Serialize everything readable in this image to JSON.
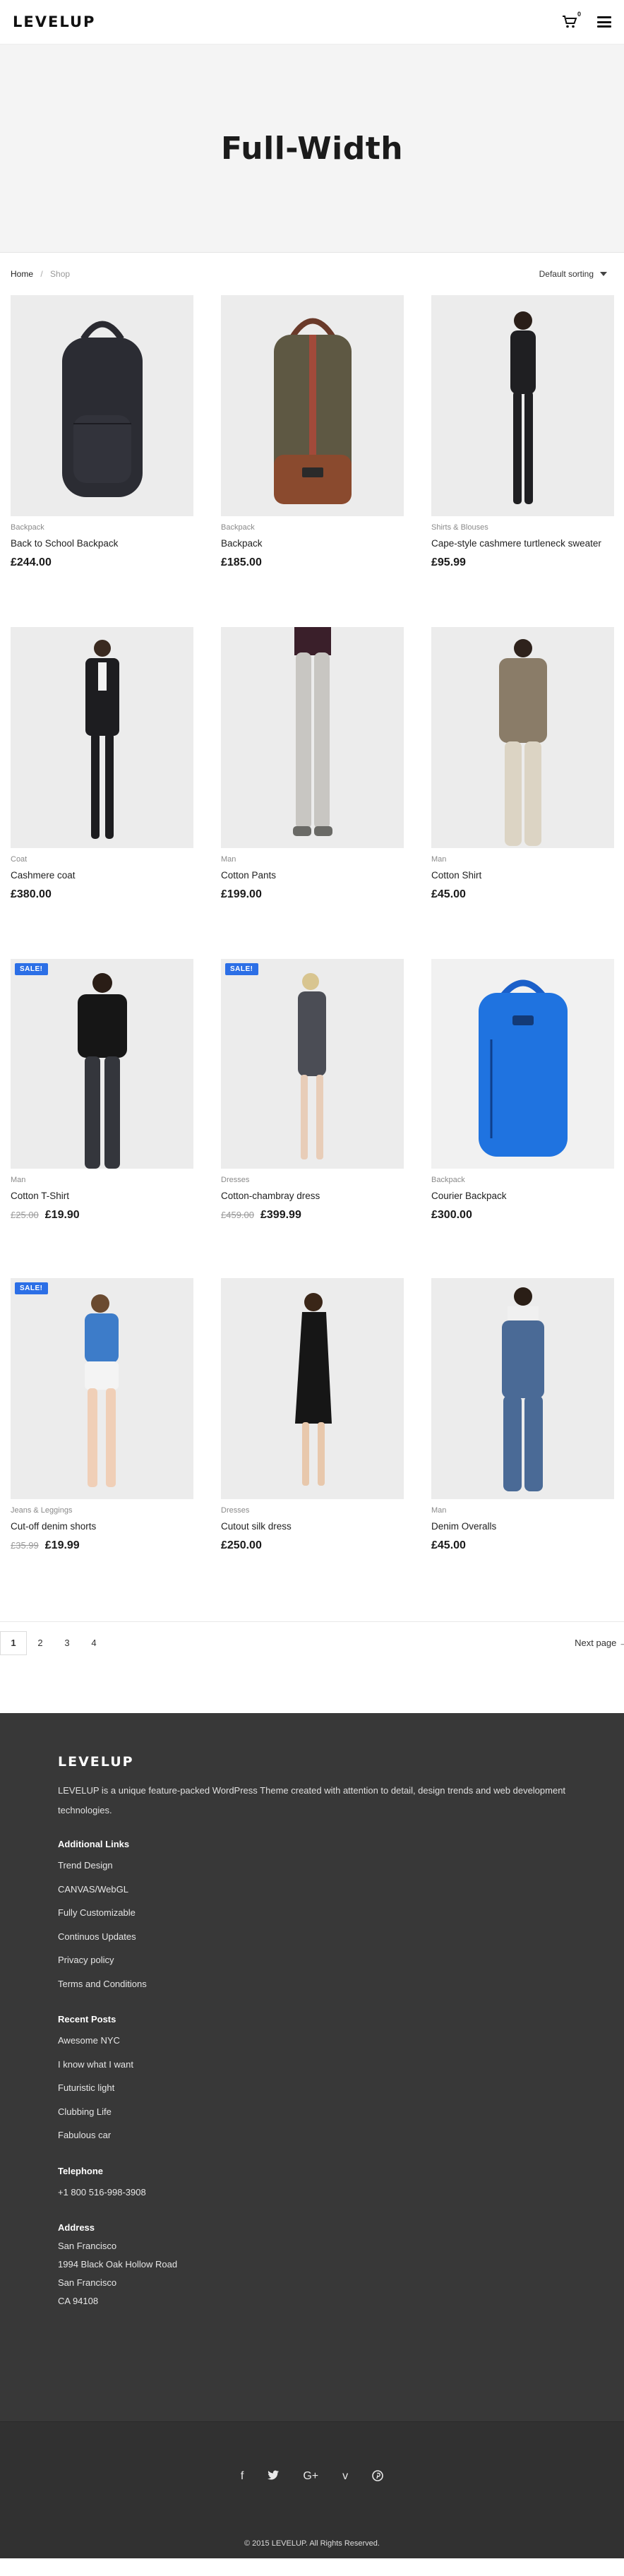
{
  "header": {
    "logo": "LEVELUP",
    "cart_count": "0"
  },
  "hero": {
    "title": "Full-Width"
  },
  "breadcrumb": {
    "home": "Home",
    "separator": "/",
    "current": "Shop"
  },
  "sorting": {
    "selected": "Default sorting"
  },
  "products": [
    {
      "category": "Backpack",
      "name": "Back to School Backpack",
      "price": "£244.00",
      "old_price": "",
      "sale": ""
    },
    {
      "category": "Backpack",
      "name": "Backpack",
      "price": "£185.00",
      "old_price": "",
      "sale": ""
    },
    {
      "category": "Shirts & Blouses",
      "name": "Cape-style cashmere turtleneck sweater",
      "price": "£95.99",
      "old_price": "",
      "sale": ""
    },
    {
      "category": "Coat",
      "name": "Cashmere coat",
      "price": "£380.00",
      "old_price": "",
      "sale": ""
    },
    {
      "category": "Man",
      "name": "Cotton Pants",
      "price": "£199.00",
      "old_price": "",
      "sale": ""
    },
    {
      "category": "Man",
      "name": "Cotton Shirt",
      "price": "£45.00",
      "old_price": "",
      "sale": ""
    },
    {
      "category": "Man",
      "name": "Cotton T-Shirt",
      "price": "£19.90",
      "old_price": "£25.00",
      "sale": "SALE!"
    },
    {
      "category": "Dresses",
      "name": "Cotton-chambray dress",
      "price": "£399.99",
      "old_price": "£459.00",
      "sale": "SALE!"
    },
    {
      "category": "Backpack",
      "name": "Courier Backpack",
      "price": "£300.00",
      "old_price": "",
      "sale": ""
    },
    {
      "category": "Jeans & Leggings",
      "name": "Cut-off denim shorts",
      "price": "£19.99",
      "old_price": "£35.99",
      "sale": "SALE!"
    },
    {
      "category": "Dresses",
      "name": "Cutout silk dress",
      "price": "£250.00",
      "old_price": "",
      "sale": ""
    },
    {
      "category": "Man",
      "name": "Denim Overalls",
      "price": "£45.00",
      "old_price": "",
      "sale": ""
    }
  ],
  "pagination": {
    "pages": [
      "1",
      "2",
      "3",
      "4"
    ],
    "active": "1",
    "next": "Next page →"
  },
  "footer": {
    "logo": "LEVELUP",
    "description": "LEVELUP is a unique feature-packed WordPress Theme created with attention to detail, design trends and web development technologies.",
    "links_heading": "Additional Links",
    "links": [
      "Trend Design",
      "CANVAS/WebGL",
      "Fully Customizable",
      "Continuos Updates",
      "Privacy policy",
      "Terms and Conditions"
    ],
    "posts_heading": "Recent Posts",
    "posts": [
      "Awesome NYC",
      "I know what I want",
      "Futuristic light",
      "Clubbing Life",
      "Fabulous car"
    ],
    "telephone_heading": "Telephone",
    "telephone": "+1 800 516-998-3908",
    "address_heading": "Address",
    "address": [
      "San Francisco",
      "1994 Black Oak Hollow Road",
      "San Francisco",
      "CA 94108"
    ],
    "social_icons": [
      "facebook-icon",
      "twitter-icon",
      "google-plus-icon",
      "vimeo-icon",
      "pinterest-icon"
    ],
    "copyright": "© 2015 LEVELUP. All Rights Reserved."
  },
  "colors": {
    "sale_badge": "#2c6fe6",
    "footer_bg": "#383838",
    "hero_bg": "#f4f4f4"
  }
}
